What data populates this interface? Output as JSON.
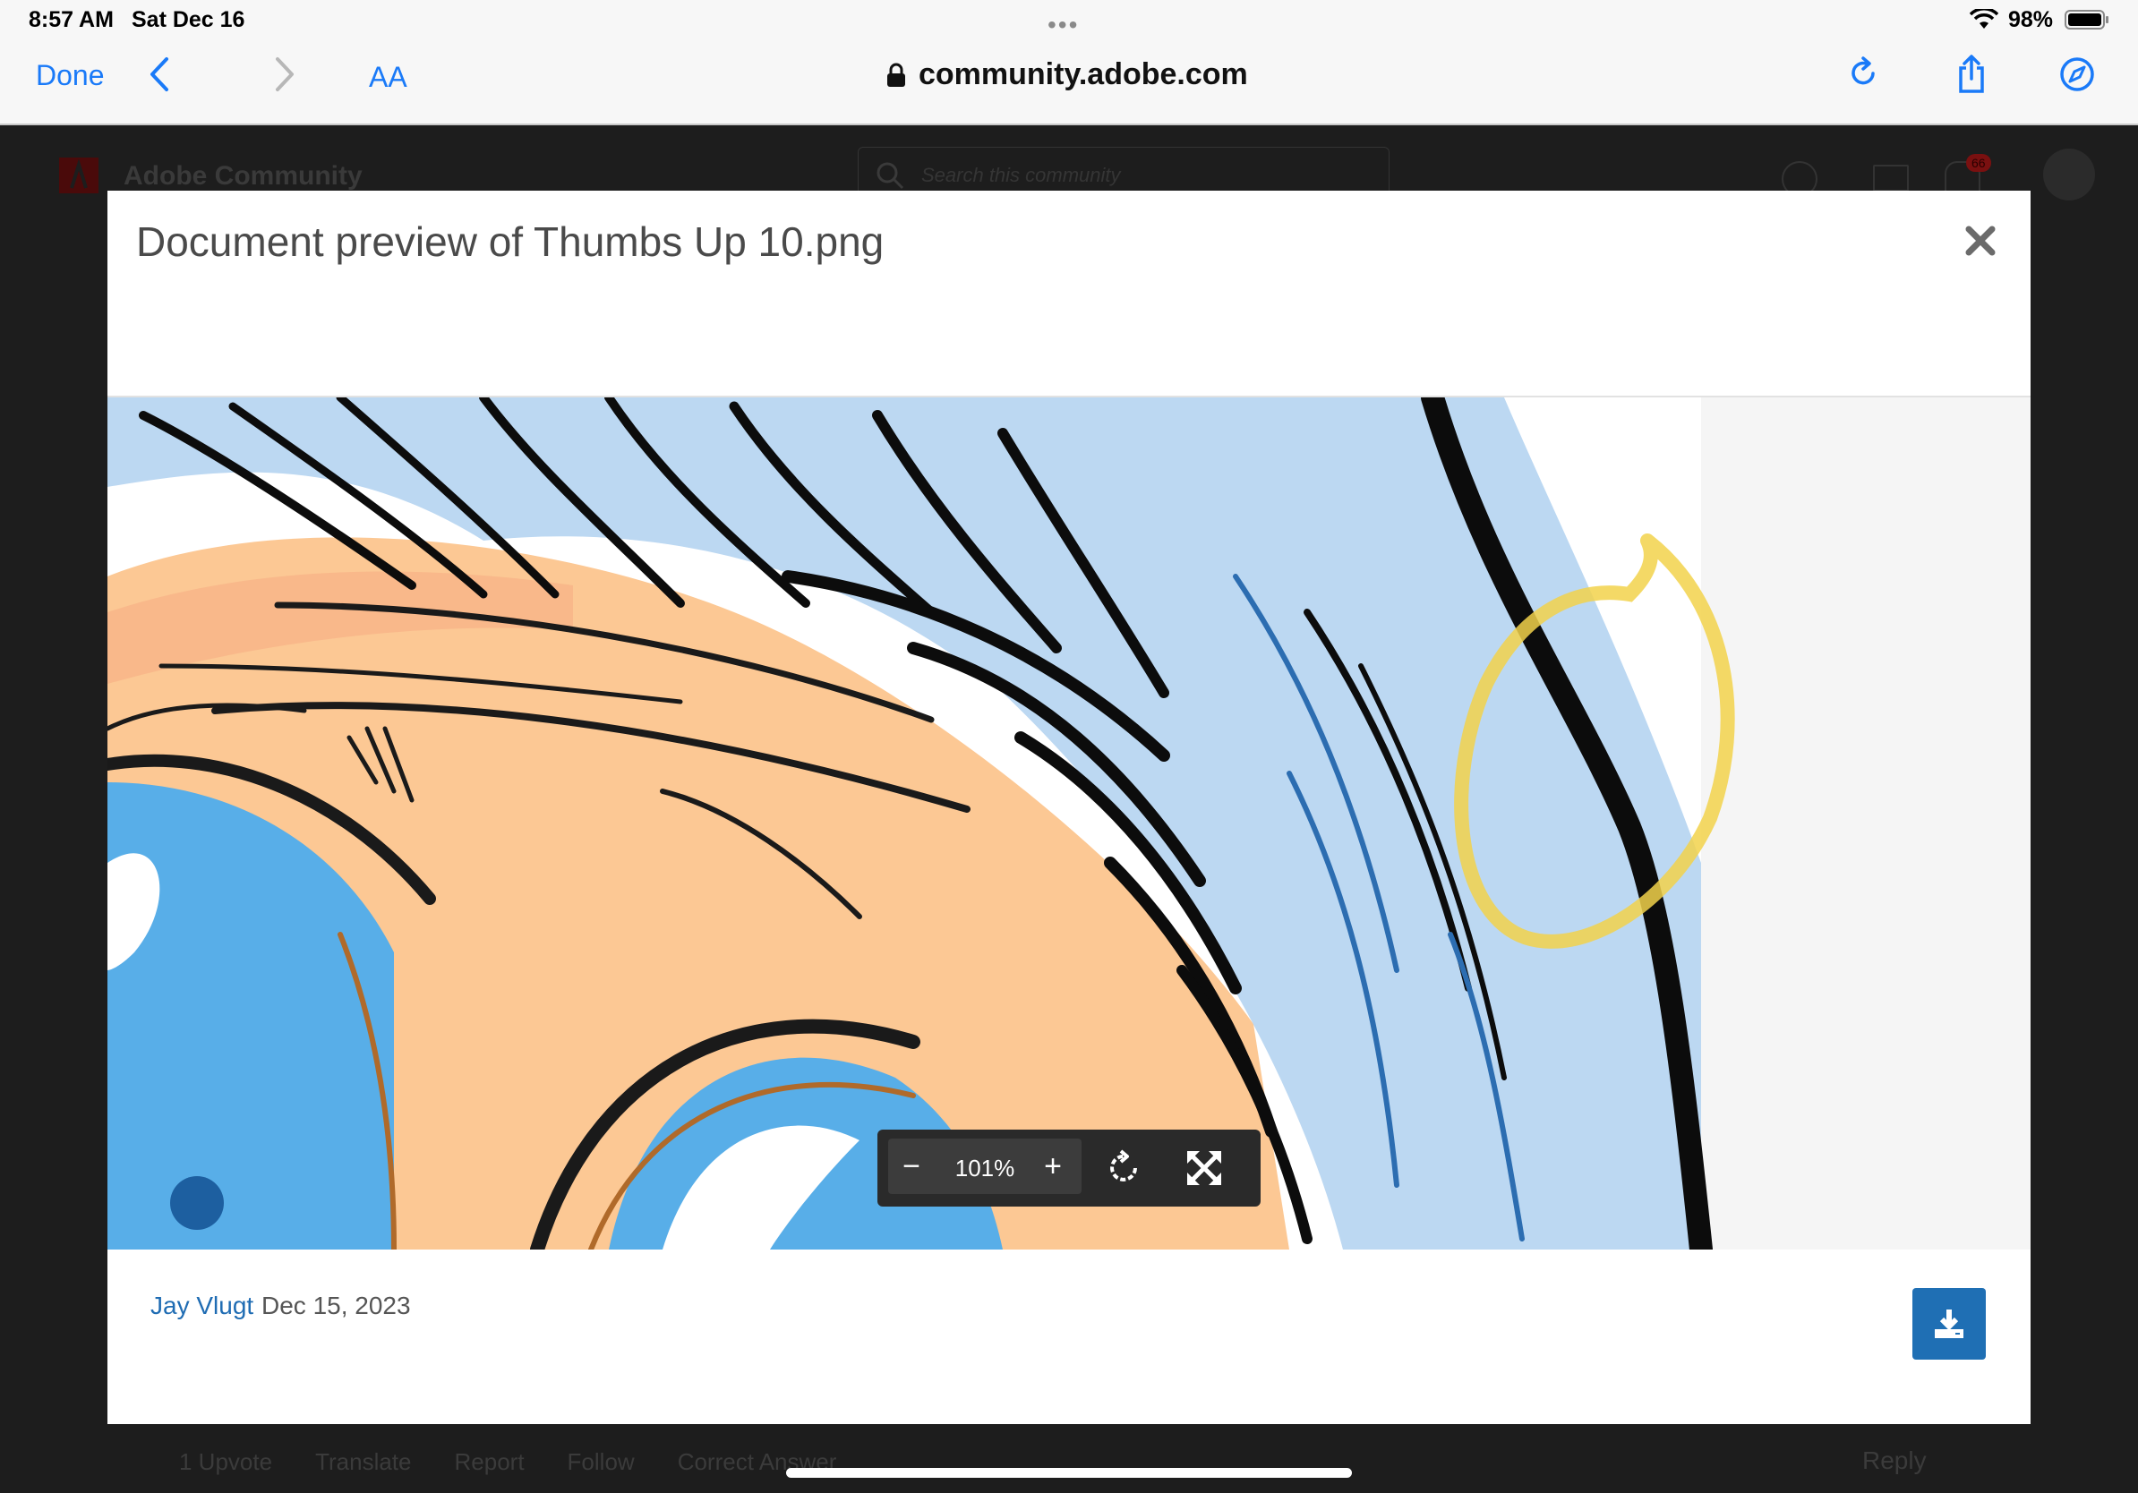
{
  "status_bar": {
    "time": "8:57 AM",
    "date": "Sat Dec 16",
    "battery": "98%"
  },
  "browser": {
    "done_label": "Done",
    "text_size_label": "AA",
    "url": "community.adobe.com",
    "icons": [
      "back-icon",
      "forward-icon",
      "reload-icon",
      "share-icon",
      "compass-icon",
      "lock-icon"
    ]
  },
  "background_page": {
    "site_title": "Adobe Community",
    "search_placeholder": "Search this community",
    "notification_count": "66",
    "actions": [
      "1 Upvote",
      "Translate",
      "Report",
      "Follow",
      "Correct Answer"
    ],
    "reply_label": "Reply"
  },
  "modal": {
    "title": "Document preview of Thumbs Up 10.png",
    "zoom_out_label": "−",
    "zoom_level": "101%",
    "zoom_in_label": "+",
    "author": "Jay Vlugt",
    "date": "Dec 15, 2023"
  },
  "colors": {
    "link": "#1f6cb3",
    "ios_blue": "#1a7af8",
    "download_button": "#1f6fb4",
    "annotation_circle": "#f2d24b"
  }
}
